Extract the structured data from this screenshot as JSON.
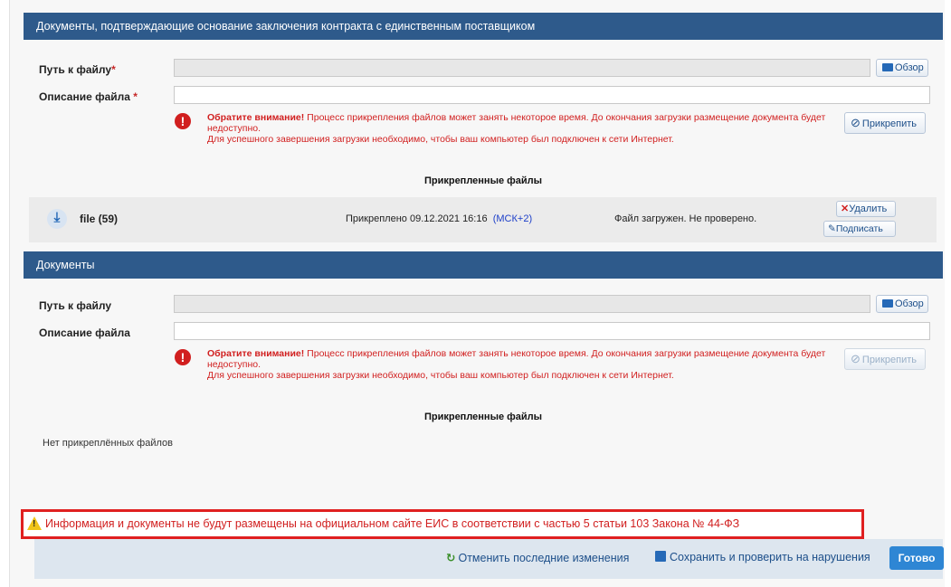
{
  "section1": {
    "title": "Документы, подтверждающие основание заключения контракта с единственным поставщиком",
    "file_path_label": "Путь к файлу",
    "file_path_required": "*",
    "file_desc_label": "Описание файла ",
    "file_desc_required": "*",
    "browse_label": "Обзор",
    "warning_bold": "Обратите внимание!",
    "warning_text": " Процесс прикрепления файлов может занять некоторое время. До окончания загрузки размещение документа будет недоступно.",
    "warning_text2": "Для успешного завершения загрузки необходимо, чтобы ваш компьютер был подключен к сети Интернет.",
    "attach_label": "Прикрепить",
    "attached_title": "Прикрепленные файлы",
    "files": [
      {
        "name": "file (59)",
        "date": "Прикреплено 09.12.2021 16:16",
        "timezone": "(МСК+2)",
        "status": "Файл загружен. Не проверено.",
        "delete_label": "Удалить",
        "sign_label": "Подписать"
      }
    ]
  },
  "section2": {
    "title": "Документы",
    "file_path_label": "Путь к файлу",
    "file_desc_label": "Описание файла",
    "browse_label": "Обзор",
    "warning_bold": "Обратите внимание!",
    "warning_text": " Процесс прикрепления файлов может занять некоторое время. До окончания загрузки размещение документа будет недоступно.",
    "warning_text2": "Для успешного завершения загрузки необходимо, чтобы ваш компьютер был подключен к сети Интернет.",
    "attach_label": "Прикрепить",
    "attached_title": "Прикрепленные файлы",
    "no_files": "Нет прикреплённых файлов"
  },
  "notice": {
    "text": "Информация и документы не будут размещены на официальном сайте ЕИС в соответствии с частью 5 статьи 103 Закона № 44-ФЗ"
  },
  "footer": {
    "undo_label": "Отменить последние изменения",
    "save_label": "Сохранить и проверить на нарушения",
    "done_label": "Готово"
  },
  "colors": {
    "header_bg": "#2e5a8b",
    "warning_red": "#d11f1f",
    "link_blue": "#1d4f8a",
    "done_blue": "#2e86d4"
  }
}
